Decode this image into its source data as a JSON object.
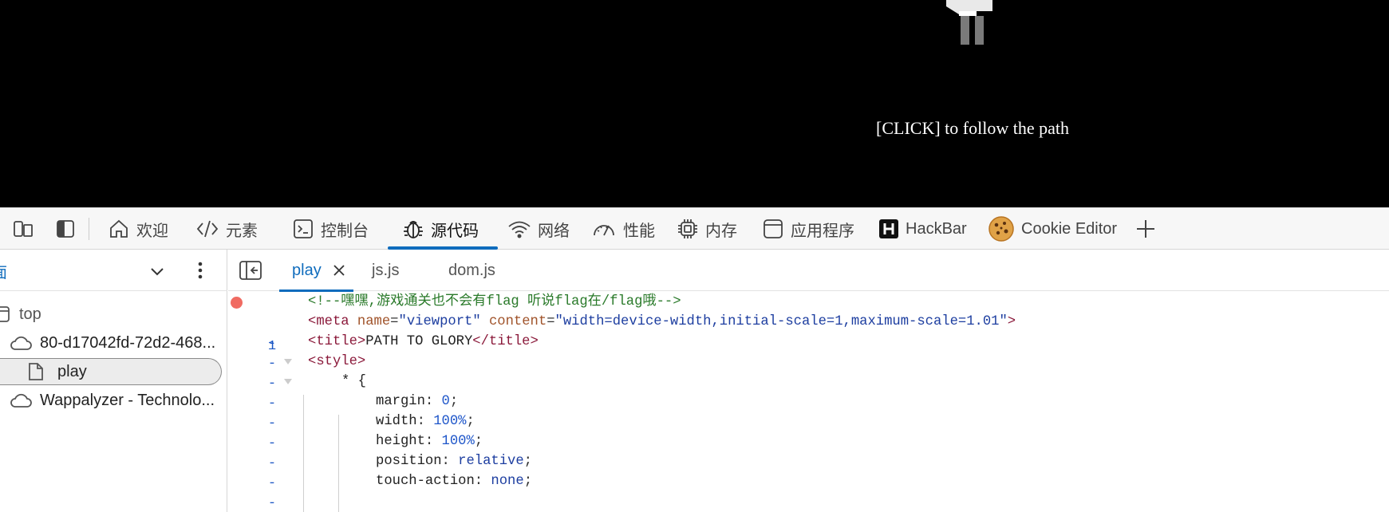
{
  "game": {
    "instruction": "[CLICK] to follow the path"
  },
  "devtools": {
    "tabs": [
      {
        "label": "欢迎",
        "icon": "home-icon"
      },
      {
        "label": "元素",
        "icon": "code-brackets-icon"
      },
      {
        "label": "控制台",
        "icon": "console-icon"
      },
      {
        "label": "源代码",
        "icon": "bug-icon",
        "active": true
      },
      {
        "label": "网络",
        "icon": "wifi-icon"
      },
      {
        "label": "性能",
        "icon": "gauge-icon"
      },
      {
        "label": "内存",
        "icon": "chip-icon"
      },
      {
        "label": "应用程序",
        "icon": "app-window-icon"
      },
      {
        "label": "HackBar",
        "icon": "hackbar-icon"
      },
      {
        "label": "Cookie Editor",
        "icon": "cookie-icon"
      }
    ],
    "accent_color": "#0f6cbd"
  },
  "navigator": {
    "header_label": "面",
    "tree": [
      {
        "label": "top",
        "icon": "frame-icon"
      },
      {
        "label": "80-d17042fd-72d2-468...",
        "icon": "cloud-icon"
      },
      {
        "label": "play",
        "icon": "file-icon",
        "selected": true
      },
      {
        "label": "Wappalyzer - Technolo...",
        "icon": "cloud-icon"
      }
    ]
  },
  "editor": {
    "file_tabs": [
      {
        "label": "play",
        "active": true
      },
      {
        "label": "js.js"
      },
      {
        "label": "dom.js"
      }
    ],
    "line_numbers": [
      "1",
      "-",
      "-",
      "-",
      "-",
      "-",
      "-",
      "-",
      "-",
      "-"
    ],
    "lines": {
      "l1": "<!--嘿嘿,游戏通关也不会有flag 听说flag在/flag哦-->",
      "l2_tag_open": "<meta",
      "l2_attr1": "name",
      "l2_val1": "\"viewport\"",
      "l2_attr2": "content",
      "l2_val2": "\"width=device-width,initial-scale=1,maximum-scale=1.01\"",
      "l2_close": ">",
      "l3_open": "<title>",
      "l3_text": "PATH TO GLORY",
      "l3_close": "</title>",
      "l4": "<style>",
      "l5": "* {",
      "l6_prop": "margin",
      "l6_val": "0",
      "l7_prop": "width",
      "l7_val": "100%",
      "l8_prop": "height",
      "l8_val": "100%",
      "l9_prop": "position",
      "l9_val": "relative",
      "l10_prop": "touch-action",
      "l10_val": "none"
    }
  }
}
